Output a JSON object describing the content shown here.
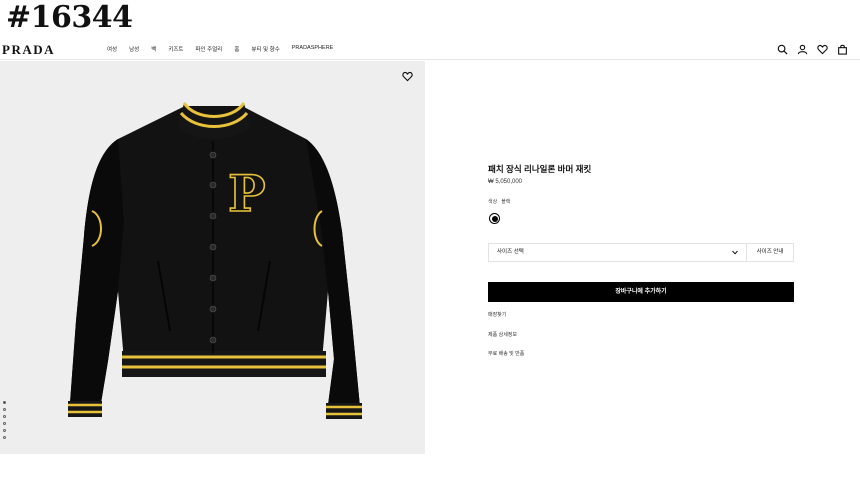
{
  "overlay_tag": "#16344",
  "brand": {
    "logo": "PRADA"
  },
  "nav": {
    "items": [
      "여성",
      "남성",
      "백",
      "키즈트",
      "파인 주얼리",
      "홈",
      "뷰티 및 향수",
      "PRADASPHERE"
    ]
  },
  "header_icons": [
    "search-icon",
    "account-icon",
    "wishlist-icon",
    "shopping-bag-icon"
  ],
  "gallery": {
    "image_count": 6,
    "active_index": 0,
    "jacket_color": "#101010",
    "stripe_color": "#e8c23a",
    "background": "#eeeeef"
  },
  "product": {
    "title": "패치 장식 리나일론 바머 재킷",
    "price": "₩ 5,050,000",
    "color_label": "색상",
    "color_value": "블랙",
    "swatch_color": "#000000",
    "size_select_label": "사이즈 선택",
    "size_guide_label": "사이즈 안내",
    "add_to_cart_label": "장바구니에 추가하기",
    "links": [
      "매장찾기",
      "제품 상세정보",
      "무료 배송 및 반품"
    ]
  }
}
